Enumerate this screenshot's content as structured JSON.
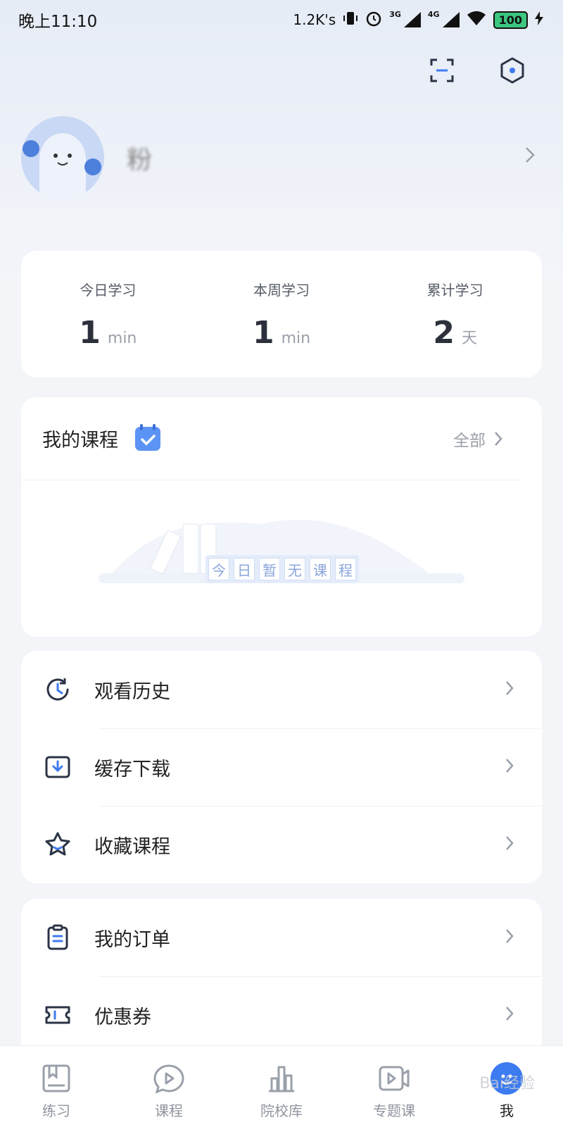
{
  "status_bar": {
    "time": "晚上11:10",
    "net_speed": "1.2K's",
    "sig1": "3G",
    "sig2": "4G",
    "battery": "100"
  },
  "profile": {
    "name": "粉"
  },
  "stats": [
    {
      "label": "今日学习",
      "value": "1",
      "unit": "min"
    },
    {
      "label": "本周学习",
      "value": "1",
      "unit": "min"
    },
    {
      "label": "累计学习",
      "value": "2",
      "unit": "天"
    }
  ],
  "my_course": {
    "title": "我的课程",
    "all_label": "全部",
    "empty_chars": [
      "今",
      "日",
      "暂",
      "无",
      "课",
      "程"
    ]
  },
  "menu_a": [
    {
      "label": "观看历史",
      "icon": "history-icon"
    },
    {
      "label": "缓存下载",
      "icon": "download-icon"
    },
    {
      "label": "收藏课程",
      "icon": "star-icon"
    }
  ],
  "menu_b": [
    {
      "label": "我的订单",
      "icon": "clipboard-icon"
    },
    {
      "label": "优惠券",
      "icon": "ticket-icon"
    }
  ],
  "tabs": [
    {
      "label": "练习",
      "icon": "practice-icon"
    },
    {
      "label": "课程",
      "icon": "course-icon"
    },
    {
      "label": "院校库",
      "icon": "college-icon"
    },
    {
      "label": "专题课",
      "icon": "topic-video-icon"
    },
    {
      "label": "我",
      "icon": "me-icon",
      "active": true
    }
  ],
  "watermark": "Bai经验",
  "colors": {
    "accent": "#3d7bf0",
    "background": "#f3f5f9"
  }
}
